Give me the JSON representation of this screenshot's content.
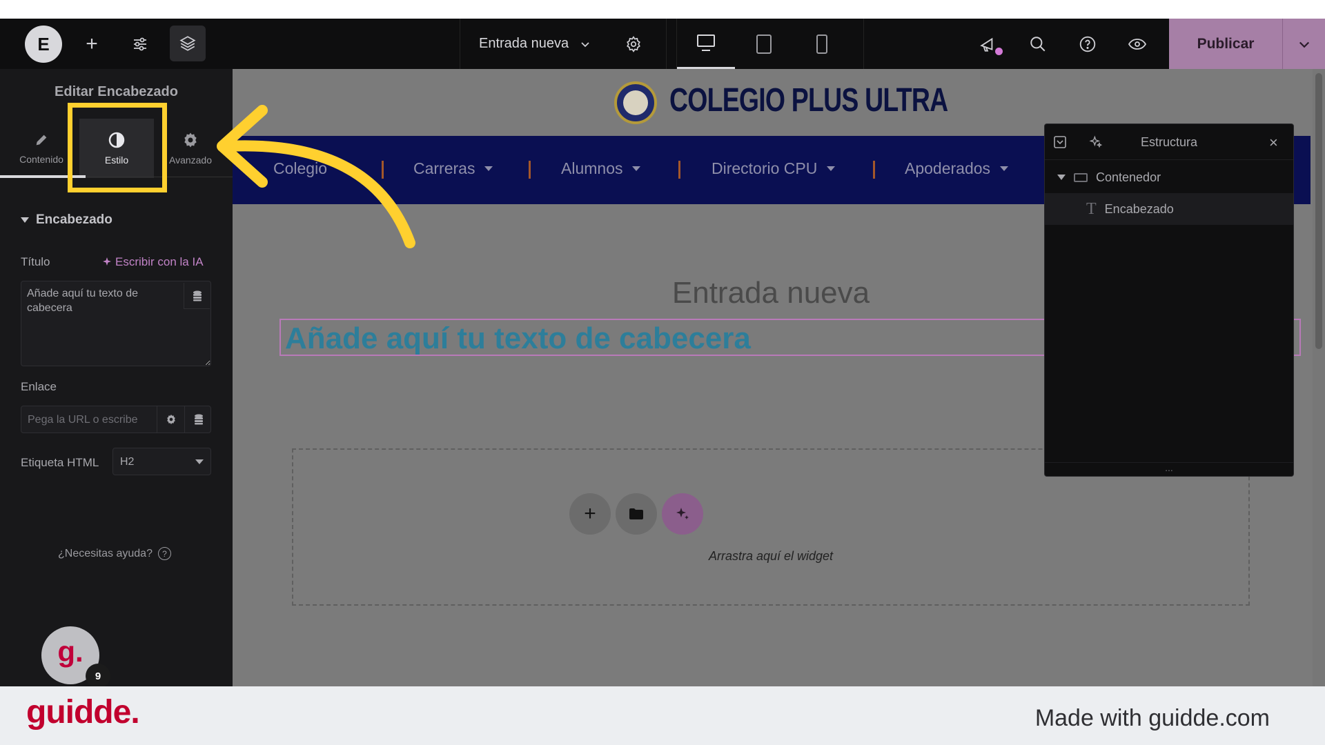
{
  "topbar": {
    "logo_letter": "E",
    "document_title": "Entrada nueva",
    "publish_label": "Publicar",
    "accent_color": "#a67fa6"
  },
  "panel": {
    "title": "Editar Encabezado",
    "tabs": [
      {
        "label": "Contenido",
        "icon": "pencil-icon"
      },
      {
        "label": "Estilo",
        "icon": "contrast-icon"
      },
      {
        "label": "Avanzado",
        "icon": "gear-icon"
      }
    ],
    "active_tab": "Estilo",
    "section_title": "Encabezado",
    "title_label": "Título",
    "ai_link": "Escribir con la IA",
    "title_value": "Añade aquí tu texto de cabecera",
    "link_label": "Enlace",
    "link_placeholder": "Pega la URL o escribe",
    "html_tag_label": "Etiqueta HTML",
    "html_tag_value": "H2",
    "help_text": "¿Necesitas ayuda?"
  },
  "avatar": {
    "letter": "g.",
    "badge": "9"
  },
  "site": {
    "name": "COLEGIO PLUS ULTRA",
    "nav": [
      {
        "label": "Colegio",
        "dropdown": false
      },
      {
        "label": "Carreras",
        "dropdown": true
      },
      {
        "label": "Alumnos",
        "dropdown": true
      },
      {
        "label": "Directorio CPU",
        "dropdown": true
      },
      {
        "label": "Apoderados",
        "dropdown": true
      }
    ],
    "nav_color": "#0a0f52"
  },
  "canvas": {
    "post_title": "Entrada nueva",
    "heading_text": "Añade aquí tu texto de cabecera",
    "dropzone_text": "Arrastra aquí el widget"
  },
  "structure": {
    "title": "Estructura",
    "items": [
      {
        "label": "Contenedor",
        "icon": "container-icon"
      },
      {
        "label": "Encabezado",
        "icon": "heading-icon"
      }
    ],
    "footer": "..."
  },
  "footer": {
    "brand": "guidde.",
    "made_with": "Made with guidde.com"
  },
  "highlight_color": "#ffd02f"
}
